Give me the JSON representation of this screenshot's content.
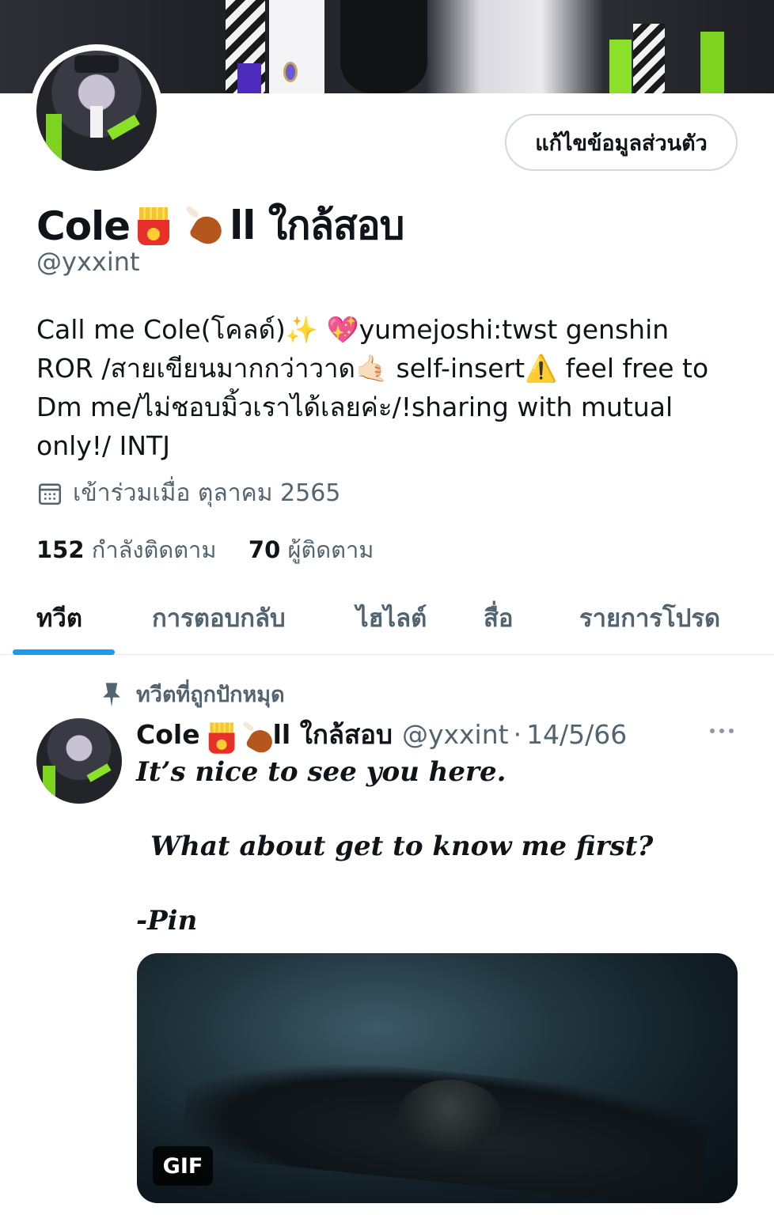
{
  "profile": {
    "edit_button": "แก้ไขข้อมูลส่วนตัว",
    "name_prefix": "Cole",
    "name_suffix": "ll ใกล้สอบ",
    "handle": "@yxxint",
    "bio_lines": [
      "Call me Cole(โคลด์)✨ 💖yumejoshi:twst genshin",
      "ROR /สายเขียนมากกว่าวาด🤙🏻 self-insert⚠️ feel free to",
      "Dm me/ไม่ชอบมิ้วเราได้เลยค่ะ/!sharing with mutual",
      "only!/ INTJ"
    ],
    "joined": "เข้าร่วมเมื่อ ตุลาคม 2565",
    "following_count": "152",
    "following_label": "กำลังติดตาม",
    "followers_count": "70",
    "followers_label": "ผู้ติดตาม"
  },
  "tabs": [
    {
      "label": "ทวีต",
      "active": true
    },
    {
      "label": "การตอบกลับ",
      "active": false
    },
    {
      "label": "ไฮไลต์",
      "active": false
    },
    {
      "label": "สื่อ",
      "active": false
    },
    {
      "label": "รายการโปรด",
      "active": false
    }
  ],
  "pinned_tweet": {
    "pinned_label": "ทวีตที่ถูกปักหมุด",
    "author_prefix": "Cole",
    "author_suffix": "ll ใกล้สอบ",
    "handle": "@yxxint",
    "dot": "·",
    "date": "14/5/66",
    "text_lines": [
      "It’s nice to see you here.",
      "What about get to know me first?",
      "-Pin"
    ],
    "media_badge": "GIF"
  },
  "icons": {
    "calendar": "calendar-icon",
    "pin": "pin-icon",
    "more": "more-icon"
  },
  "colors": {
    "accent": "#1d9bf0",
    "text_primary": "#0f1419",
    "text_secondary": "#536471",
    "accent_green": "#7ed321"
  }
}
